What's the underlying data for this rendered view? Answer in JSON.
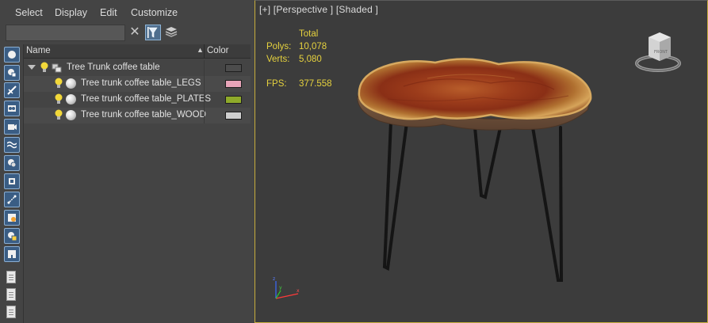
{
  "menu": {
    "items": [
      "Select",
      "Display",
      "Edit",
      "Customize"
    ]
  },
  "toolbar": {
    "search_value": "",
    "clear_icon": "close-icon",
    "filter_icon": "funnel-icon",
    "layers_icon": "layers-icon"
  },
  "tree": {
    "col_name": "Name",
    "col_sort": "▲",
    "col_color": "Color",
    "rows": [
      {
        "label": "Tree Trunk coffee table",
        "color": "#4c4c4c",
        "type": "group"
      },
      {
        "label": "Tree trunk coffee table_LEGS",
        "color": "#e7a4b8",
        "type": "object"
      },
      {
        "label": "Tree trunk coffee table_PLATES",
        "color": "#8faa2a",
        "type": "object"
      },
      {
        "label": "Tree trunk coffee table_WOOD",
        "color": "#cfcfcf",
        "type": "object"
      }
    ]
  },
  "viewport": {
    "label": "[+] [Perspective ] [Shaded ]",
    "stats": {
      "header": "Total",
      "polys_label": "Polys:",
      "polys_value": "10,078",
      "verts_label": "Verts:",
      "verts_value": "5,080",
      "fps_label": "FPS:",
      "fps_value": "377.558"
    },
    "viewcube_label": "FRONT",
    "border_color": "#c7ad3c",
    "stats_color": "#e6d23e"
  }
}
